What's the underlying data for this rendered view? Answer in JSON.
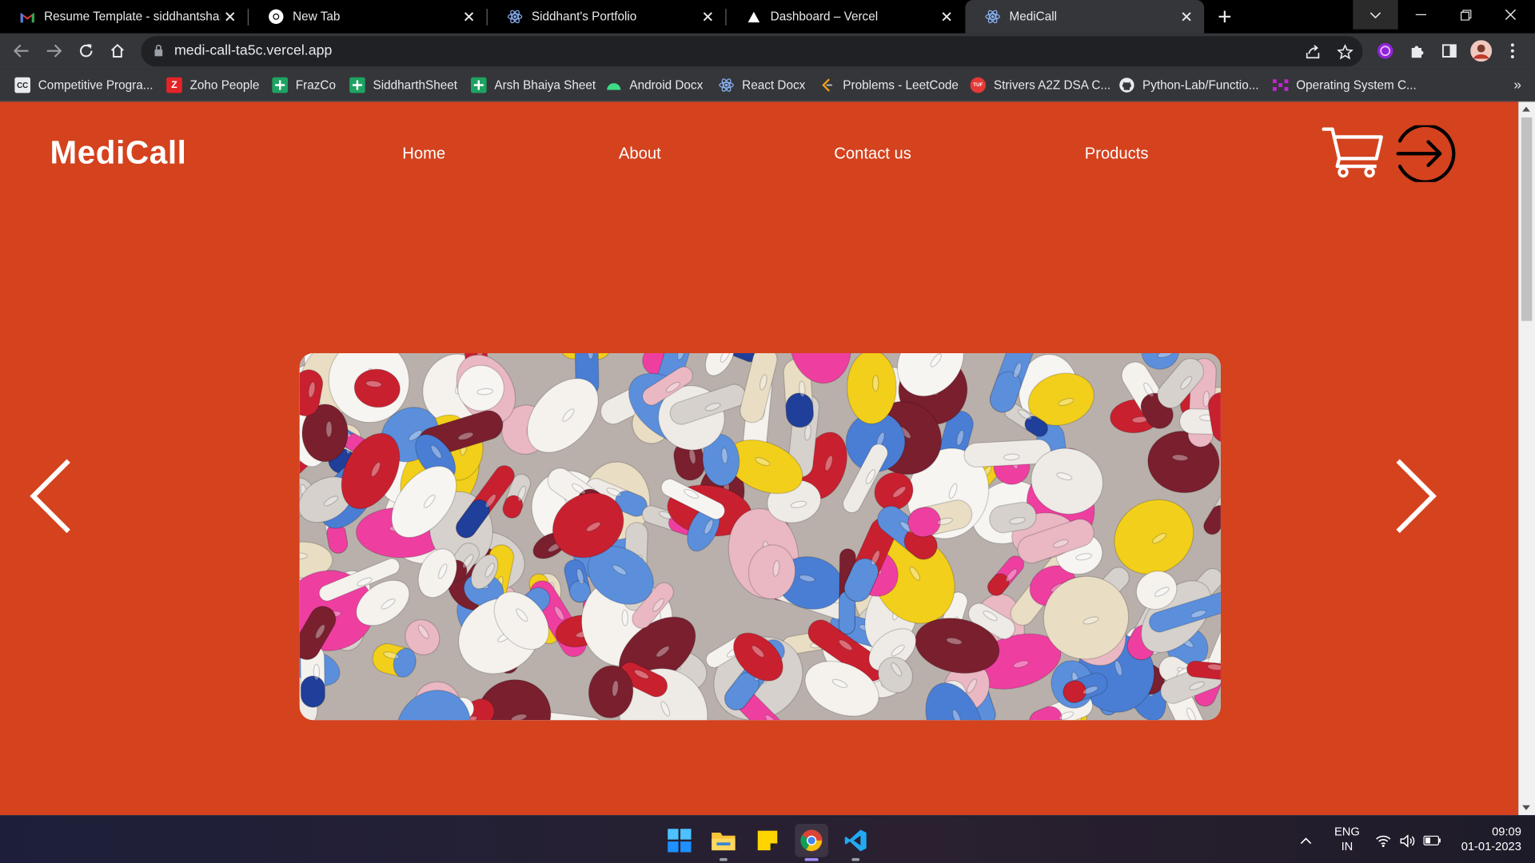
{
  "browser": {
    "tabs": [
      {
        "title": "Resume Template - siddhantshar",
        "icon": "gmail-icon"
      },
      {
        "title": "New Tab",
        "icon": "chrome-icon"
      },
      {
        "title": "Siddhant's Portfolio",
        "icon": "react-icon"
      },
      {
        "title": "Dashboard – Vercel",
        "icon": "vercel-icon"
      },
      {
        "title": "MediCall",
        "icon": "react-icon",
        "active": true
      }
    ],
    "url": "medi-call-ta5c.vercel.app",
    "bookmarks": [
      {
        "label": "Competitive Progra...",
        "icon": "cc-icon"
      },
      {
        "label": "Zoho People",
        "icon": "zoho-icon"
      },
      {
        "label": "FrazCo",
        "icon": "sheets-icon"
      },
      {
        "label": "SiddharthSheet",
        "icon": "sheets-icon"
      },
      {
        "label": "Arsh Bhaiya Sheet",
        "icon": "sheets-icon"
      },
      {
        "label": "Android Docx",
        "icon": "android-icon"
      },
      {
        "label": "React Docx",
        "icon": "react-icon"
      },
      {
        "label": "Problems - LeetCode",
        "icon": "leetcode-icon"
      },
      {
        "label": "Strivers A2Z DSA C...",
        "icon": "tuf-icon"
      },
      {
        "label": "Python-Lab/Functio...",
        "icon": "github-icon"
      },
      {
        "label": "Operating System C...",
        "icon": "os-icon"
      }
    ],
    "bookmarks_more": "»"
  },
  "site": {
    "logo": "MediCall",
    "nav": [
      "Home",
      "About",
      "Contact us",
      "Products"
    ],
    "accent_color": "#d4421e",
    "hero_alt": "pills",
    "cart_icon": "cart-icon",
    "login_icon": "login-icon"
  },
  "taskbar": {
    "apps": [
      "windows-start-icon",
      "file-explorer-icon",
      "sticky-notes-icon",
      "chrome-icon",
      "vscode-icon"
    ],
    "lang_top": "ENG",
    "lang_bottom": "IN",
    "time": "09:09",
    "date": "01-01-2023"
  }
}
